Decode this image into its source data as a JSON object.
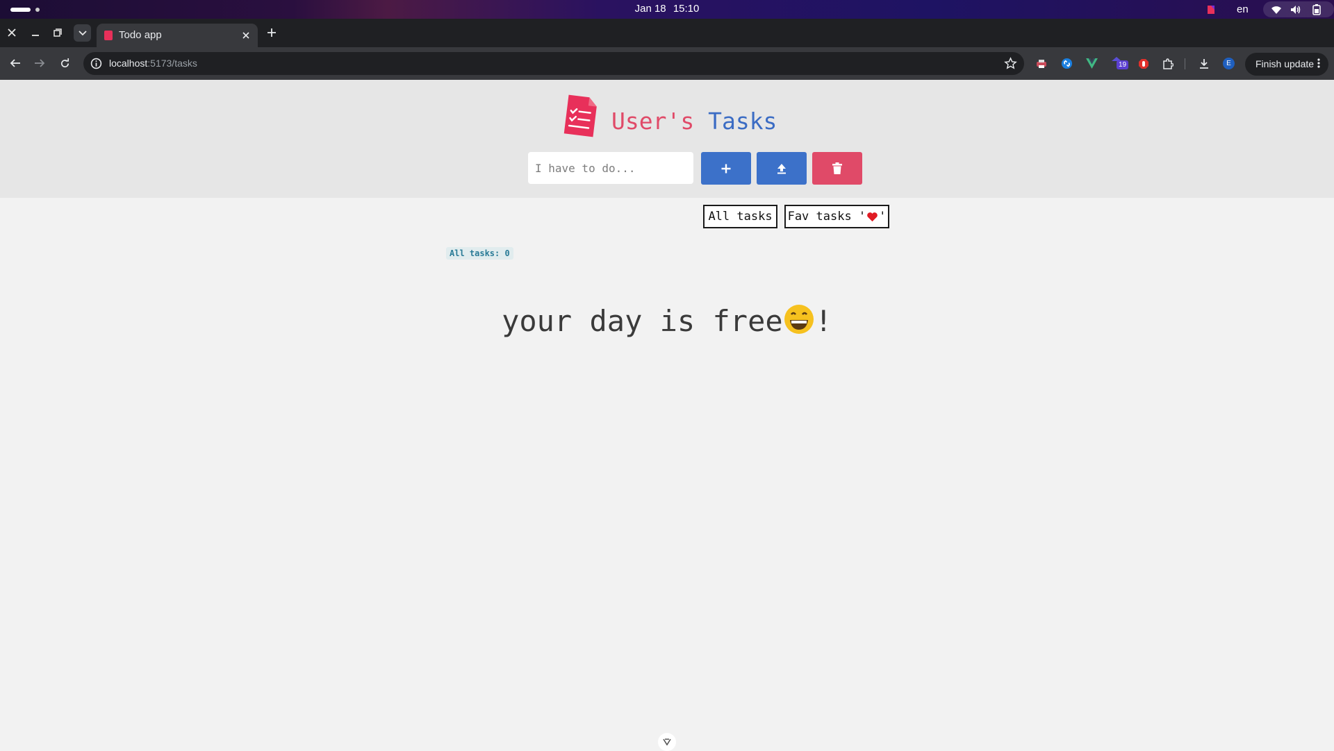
{
  "system": {
    "date": "Jan 18",
    "time": "15:10",
    "language": "en"
  },
  "browser": {
    "tab_title": "Todo app",
    "url_host": "localhost",
    "url_path": ":5173/tasks",
    "ext_badge": "19",
    "profile_initial": "E",
    "finish_update_label": "Finish update"
  },
  "app": {
    "title_part1": "User's",
    "title_part2": " Tasks",
    "input_placeholder": "I have to do...",
    "filters": {
      "all_label": "All tasks",
      "fav_label_prefix": "Fav tasks '",
      "fav_label_suffix": "'"
    },
    "count_label": "All tasks: 0",
    "empty_text": "your day is free",
    "empty_suffix": "!"
  },
  "colors": {
    "accent_red": "#e04a68",
    "accent_blue": "#3c71c9"
  },
  "icons": [
    "plus-icon",
    "upload-icon",
    "trash-icon",
    "heart-icon",
    "grinning-face-emoji"
  ]
}
